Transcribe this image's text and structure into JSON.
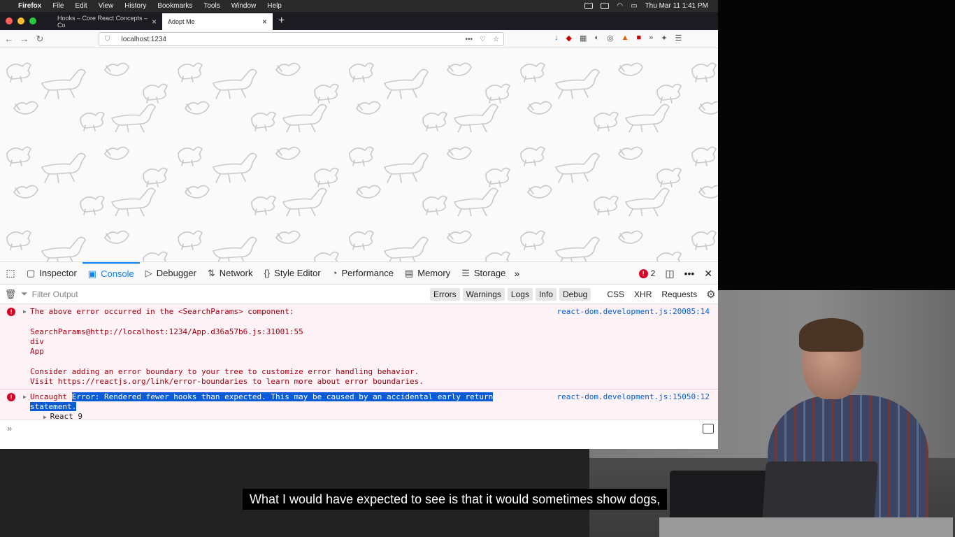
{
  "menubar": {
    "app": "Firefox",
    "items": [
      "File",
      "Edit",
      "View",
      "History",
      "Bookmarks",
      "Tools",
      "Window",
      "Help"
    ],
    "clock": "Thu Mar 11  1:41 PM"
  },
  "browser": {
    "tabs": [
      {
        "title": "Hooks – Core React Concepts – Co"
      },
      {
        "title": "Adopt Me"
      }
    ],
    "url": "localhost:1234"
  },
  "devtools": {
    "tabs": [
      "Inspector",
      "Console",
      "Debugger",
      "Network",
      "Style Editor",
      "Performance",
      "Memory",
      "Storage"
    ],
    "error_count": "2",
    "filter_placeholder": "Filter Output",
    "filters": [
      "Errors",
      "Warnings",
      "Logs",
      "Info",
      "Debug",
      "CSS",
      "XHR",
      "Requests"
    ],
    "messages": [
      {
        "lines": [
          "The above error occurred in the <SearchParams> component:",
          "",
          "SearchParams@http://localhost:1234/App.d36a57b6.js:31001:55",
          "div",
          "App",
          "",
          "Consider adding an error boundary to your tree to customize error handling behavior.",
          "Visit https://reactjs.org/link/error-boundaries to learn more about error boundaries."
        ],
        "source": "react-dom.development.js:20085:14"
      },
      {
        "prefix": "Uncaught ",
        "selected_1": "Error: Rendered fewer hooks than expected. This may be caused by an accidental early return",
        "selected_2": "statement.",
        "child": "React 9",
        "source": "react-dom.development.js:15050:12"
      }
    ]
  },
  "caption": "What I would have expected to see is that it would sometimes show dogs,"
}
